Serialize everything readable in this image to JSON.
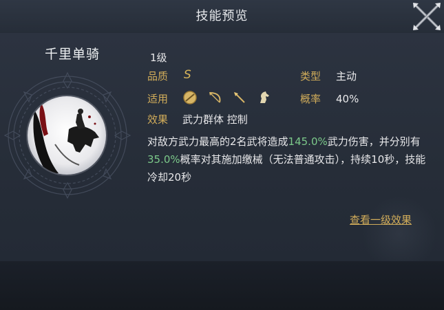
{
  "header": {
    "title": "技能预览",
    "close_icon": "close-x-icon"
  },
  "skill": {
    "name": "千里单骑",
    "level": "1级",
    "quality_label": "品质",
    "quality_value": "S",
    "type_label": "类型",
    "type_value": "主动",
    "apply_label": "适用",
    "apply_icons": [
      "shield-unit-icon",
      "bow-unit-icon",
      "spear-unit-icon",
      "cavalry-unit-icon"
    ],
    "rate_label": "概率",
    "rate_value": "40%",
    "effect_label": "效果",
    "effect_tags": "武力群体 控制",
    "description": {
      "part1": "对敌方武力最高的2名武将造成",
      "value1": "145.0%",
      "part2": "武力伤害，并分别有",
      "value2": "35.0%",
      "part3": "概率对其施加缴械（无法普通攻击），持续10秒，技能冷却20秒"
    },
    "view_link": "查看一级效果"
  },
  "colors": {
    "gold": "#d2ad5a",
    "highlight": "#7cc98a",
    "text": "#e8e8ea"
  }
}
